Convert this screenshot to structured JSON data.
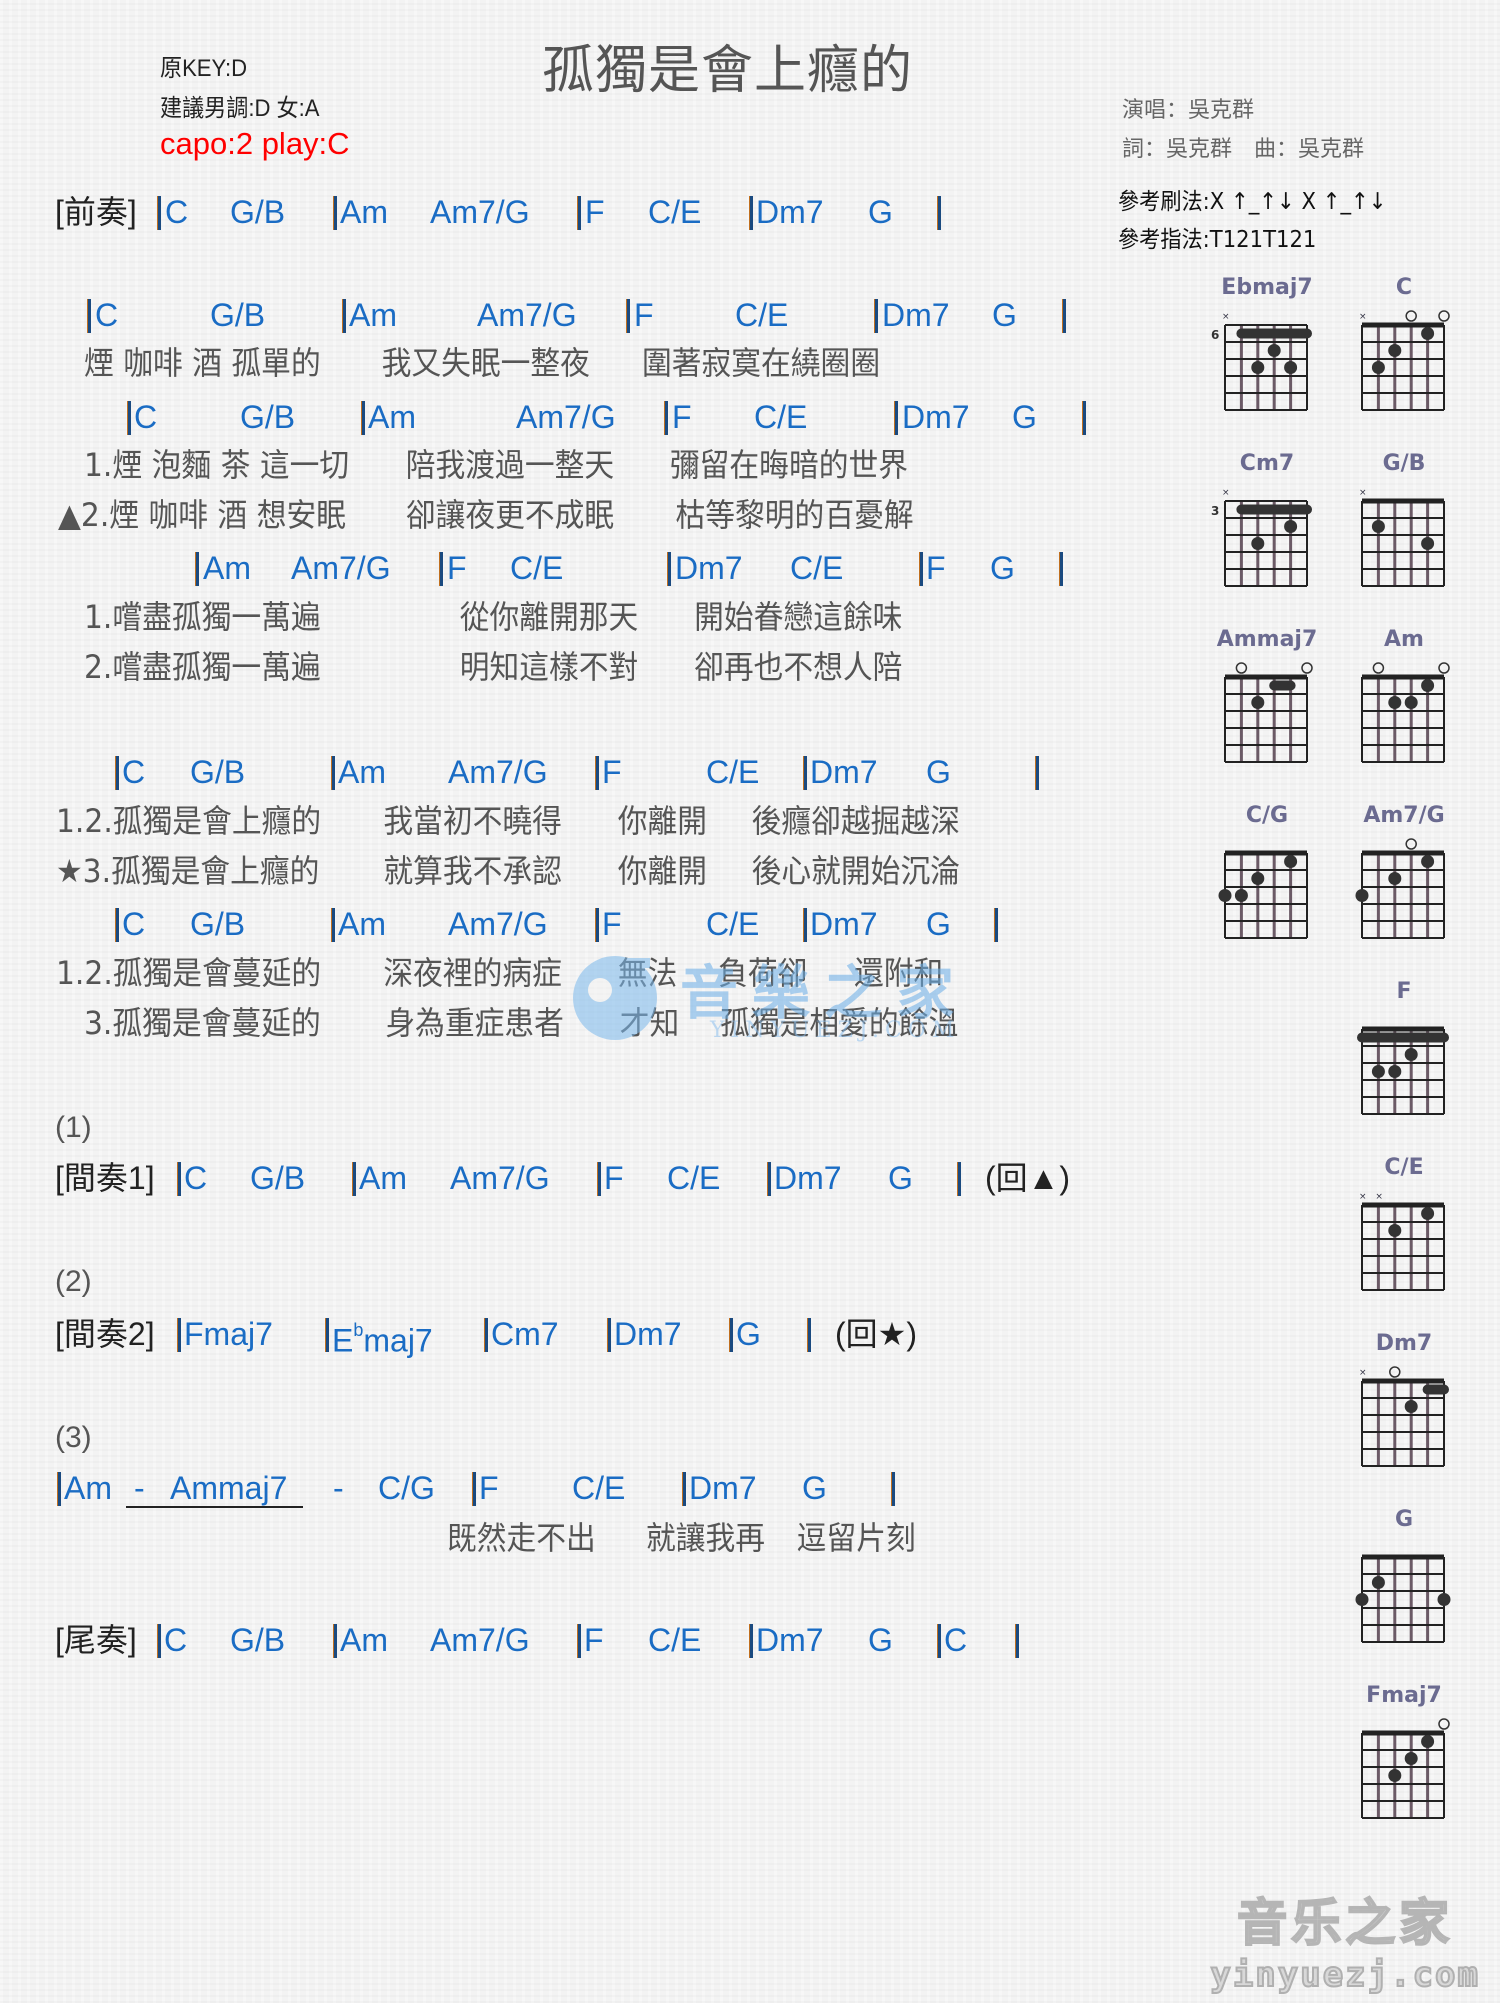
{
  "header": {
    "title": "孤獨是會上癮的",
    "original_key": "原KEY:D",
    "suggested_key": "建議男調:D 女:A",
    "capo": "capo:2 play:C",
    "singer": "演唱：吳克群",
    "credits": "詞：吳克群　曲：吳克群",
    "strum": "參考刷法:X ↑_↑↓ X ↑_↑↓",
    "picking": "參考指法:T121T121"
  },
  "sections": {
    "intro": {
      "label": "[前奏]",
      "chords": [
        "C",
        "G/B",
        "Am",
        "Am7/G",
        "F",
        "C/E",
        "Dm7",
        "G"
      ]
    },
    "verse1": {
      "chords": [
        "C",
        "G/B",
        "Am",
        "Am7/G",
        "F",
        "C/E",
        "Dm7",
        "G"
      ],
      "lyrics": [
        "煙 咖啡 酒 孤單的",
        "我又失眠一整夜",
        "圍著寂寞在繞圈圈"
      ]
    },
    "verse2": {
      "chords": [
        "C",
        "G/B",
        "Am",
        "Am7/G",
        "F",
        "C/E",
        "Dm7",
        "G"
      ],
      "lyrics_1": [
        "1.煙 泡麵 茶 這一切",
        "陪我渡過一整天",
        "彌留在晦暗的世界"
      ],
      "lyrics_2": [
        "▲2.煙 咖啡 酒 想安眠",
        "卻讓夜更不成眠",
        "枯等黎明的百憂解"
      ]
    },
    "prechorus": {
      "chords": [
        "Am",
        "Am7/G",
        "F",
        "C/E",
        "Dm7",
        "C/E",
        "F",
        "G"
      ],
      "lyrics_1": [
        "1.嚐盡孤獨一萬遍",
        "從你離開那天",
        "開始眷戀這餘味"
      ],
      "lyrics_2": [
        "2.嚐盡孤獨一萬遍",
        "明知這樣不對",
        "卻再也不想人陪"
      ]
    },
    "chorus1": {
      "chords": [
        "C",
        "G/B",
        "Am",
        "Am7/G",
        "F",
        "C/E",
        "Dm7",
        "G"
      ],
      "lyrics_1": [
        "1.2.孤獨是會上癮的",
        "我當初不曉得",
        "你離開",
        "後癮卻越掘越深"
      ],
      "lyrics_2": [
        "★3.孤獨是會上癮的",
        "就算我不承認",
        "你離開",
        "後心就開始沉淪"
      ]
    },
    "chorus2": {
      "chords": [
        "C",
        "G/B",
        "Am",
        "Am7/G",
        "F",
        "C/E",
        "Dm7",
        "G"
      ],
      "lyrics_1": [
        "1.2.孤獨是會蔓延的",
        "深夜裡的病症",
        "無法",
        "負荷卻",
        "還附和"
      ],
      "lyrics_2": [
        "3.孤獨是會蔓延的",
        "身為重症患者",
        "才知",
        "孤獨是相愛的餘溫"
      ]
    },
    "interlude1": {
      "marker": "(1)",
      "label": "[間奏1]",
      "chords": [
        "C",
        "G/B",
        "Am",
        "Am7/G",
        "F",
        "C/E",
        "Dm7",
        "G"
      ],
      "return": "(回▲)"
    },
    "interlude2": {
      "marker": "(2)",
      "label": "[間奏2]",
      "chords": [
        "Fmaj7",
        "E",
        "b",
        "maj7",
        "Cm7",
        "Dm7",
        "G"
      ],
      "return": "(回★)"
    },
    "bridge": {
      "marker": "(3)",
      "chords": [
        "Am",
        "-",
        "Ammaj7",
        "-",
        "C/G",
        "F",
        "C/E",
        "Dm7",
        "G"
      ],
      "lyrics": [
        "既然走不出",
        "就讓我再",
        "逗留片刻"
      ]
    },
    "outro": {
      "label": "[尾奏]",
      "chords": [
        "C",
        "G/B",
        "Am",
        "Am7/G",
        "F",
        "C/E",
        "Dm7",
        "G",
        "C"
      ]
    }
  },
  "chord_diagrams": [
    {
      "name": "Ebmaj7",
      "fret_label": "6",
      "muted": [
        6
      ],
      "open": [],
      "barre": {
        "fret": 1,
        "from": 5,
        "to": 1
      },
      "dots": [
        [
          3,
          2
        ],
        [
          4,
          3
        ],
        [
          2,
          3
        ]
      ]
    },
    {
      "name": "C",
      "fret_label": "",
      "muted": [
        6
      ],
      "open": [
        3,
        1
      ],
      "barre": null,
      "dots": [
        [
          2,
          1
        ],
        [
          4,
          2
        ],
        [
          5,
          3
        ]
      ]
    },
    {
      "name": "Cm7",
      "fret_label": "3",
      "muted": [
        6
      ],
      "open": [],
      "barre": {
        "fret": 1,
        "from": 5,
        "to": 1
      },
      "dots": [
        [
          2,
          2
        ],
        [
          4,
          3
        ]
      ]
    },
    {
      "name": "G/B",
      "fret_label": "",
      "muted": [
        6
      ],
      "open": [],
      "barre": null,
      "dots": [
        [
          5,
          2
        ],
        [
          2,
          3
        ]
      ]
    },
    {
      "name": "Ammaj7",
      "fret_label": "",
      "muted": [],
      "open": [
        5,
        1
      ],
      "barre": {
        "fret": 1,
        "from": 3,
        "to": 2
      },
      "dots": [
        [
          4,
          2
        ]
      ]
    },
    {
      "name": "Am",
      "fret_label": "",
      "muted": [],
      "open": [
        5,
        1
      ],
      "barre": null,
      "dots": [
        [
          2,
          1
        ],
        [
          4,
          2
        ],
        [
          3,
          2
        ]
      ]
    },
    {
      "name": "C/G",
      "fret_label": "",
      "muted": [],
      "open": [],
      "barre": null,
      "dots": [
        [
          2,
          1
        ],
        [
          4,
          2
        ],
        [
          6,
          3
        ],
        [
          5,
          3
        ]
      ]
    },
    {
      "name": "Am7/G",
      "fret_label": "",
      "muted": [],
      "open": [
        3
      ],
      "barre": null,
      "dots": [
        [
          2,
          1
        ],
        [
          4,
          2
        ],
        [
          6,
          3
        ]
      ]
    },
    {
      "name": "F",
      "fret_label": "",
      "muted": [],
      "open": [],
      "barre": {
        "fret": 1,
        "from": 6,
        "to": 1
      },
      "dots": [
        [
          3,
          2
        ],
        [
          5,
          3
        ],
        [
          4,
          3
        ]
      ]
    },
    {
      "name": "C/E",
      "fret_label": "",
      "muted": [
        6,
        5
      ],
      "open": [],
      "barre": null,
      "dots": [
        [
          2,
          1
        ],
        [
          4,
          2
        ]
      ]
    },
    {
      "name": "Dm7",
      "fret_label": "",
      "muted": [
        6
      ],
      "open": [
        4
      ],
      "barre": {
        "fret": 1,
        "from": 2,
        "to": 1
      },
      "dots": [
        [
          3,
          2
        ]
      ]
    },
    {
      "name": "G",
      "fret_label": "",
      "muted": [],
      "open": [],
      "barre": null,
      "dots": [
        [
          5,
          2
        ],
        [
          6,
          3
        ],
        [
          1,
          3
        ]
      ]
    },
    {
      "name": "Fmaj7",
      "fret_label": "",
      "muted": [],
      "open": [
        1
      ],
      "barre": null,
      "dots": [
        [
          2,
          1
        ],
        [
          3,
          2
        ],
        [
          4,
          3
        ]
      ]
    }
  ],
  "watermark": {
    "cn": "音樂之家",
    "en": "YINYUEZJ.COM"
  },
  "footer_logo": {
    "cn": "音乐之家",
    "en": "yinyuezj.com"
  }
}
